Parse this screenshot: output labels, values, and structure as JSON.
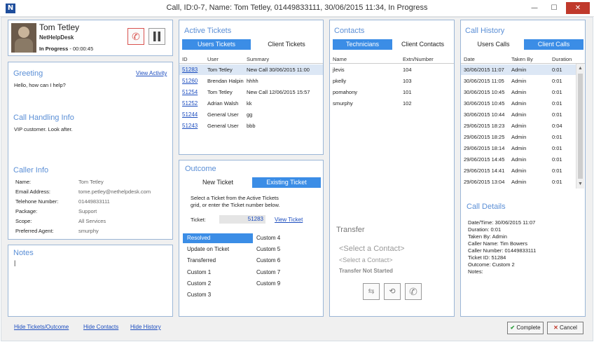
{
  "window": {
    "title": "Call, ID:0-7, Name: Tom Tetley, 01449833111, 30/06/2015 11:34, In Progress",
    "app_icon": "N",
    "minimize": "—",
    "maximize": "☐",
    "close": "✕"
  },
  "caller_card": {
    "name": "Tom Tetley",
    "company": "NetHelpDesk",
    "status": "In Progress",
    "timer": "- 00:00:45"
  },
  "greeting": {
    "title": "Greeting",
    "link": "View Activity",
    "text": "Hello, how can I help?"
  },
  "call_handling": {
    "title": "Call Handling Info",
    "text": "VIP customer. Look after."
  },
  "caller_info": {
    "title": "Caller Info",
    "rows": [
      {
        "label": "Name:",
        "value": "Tom Tetley"
      },
      {
        "label": "Email Address:",
        "value": "tome.petley@nethelpdesk.com"
      },
      {
        "label": "Telehone Number:",
        "value": "01449833111"
      },
      {
        "label": "Package:",
        "value": "Support"
      },
      {
        "label": "Scope:",
        "value": "All Services"
      },
      {
        "label": "Preferred Agent:",
        "value": "smurphy"
      }
    ]
  },
  "notes": {
    "title": "Notes",
    "cursor": "|"
  },
  "bottom_links": {
    "hide_tickets": "Hide Tickets/Outcome",
    "hide_contacts": "Hide Contacts",
    "hide_history": "Hide History"
  },
  "active_tickets": {
    "title": "Active Tickets",
    "tab_users": "Users Tickets",
    "tab_client": "Client Tickets",
    "headers": {
      "id": "ID",
      "user": "User",
      "summary": "Summary"
    },
    "rows": [
      {
        "id": "51283",
        "user": "Tom Tetley",
        "summary": "New Call 30/06/2015 11:00"
      },
      {
        "id": "51260",
        "user": "Brendan Halpin",
        "summary": "hhhh"
      },
      {
        "id": "51254",
        "user": "Tom Tetley",
        "summary": "New Call 12/06/2015 15:57"
      },
      {
        "id": "51252",
        "user": "Adrian Walsh",
        "summary": "kk"
      },
      {
        "id": "51244",
        "user": "General User",
        "summary": "gg"
      },
      {
        "id": "51243",
        "user": "General User",
        "summary": "bbb"
      }
    ]
  },
  "outcome": {
    "title": "Outcome",
    "tab_new": "New Ticket",
    "tab_existing": "Existing Ticket",
    "instruction_1": "Select a Ticket from the Active Tickets",
    "instruction_2": "grid, or enter the Ticket number below.",
    "ticket_label": "Ticket:",
    "ticket_value": "51283",
    "view_ticket": "View Ticket",
    "options_left": [
      "Resolved",
      "Update on Ticket",
      "Transferred",
      "Custom 1",
      "Custom 2",
      "Custom 3"
    ],
    "options_right": [
      "Custom 4",
      "Custom 5",
      "Custom 6",
      "Custom 7",
      "Custom 9"
    ]
  },
  "contacts": {
    "title": "Contacts",
    "tab_tech": "Technicians",
    "tab_client": "Client Contacts",
    "headers": {
      "name": "Name",
      "ext": "Extn/Number"
    },
    "rows": [
      {
        "name": "jlevis",
        "ext": "104"
      },
      {
        "name": "pkelly",
        "ext": "103"
      },
      {
        "name": "pomahony",
        "ext": "101"
      },
      {
        "name": "smurphy",
        "ext": "102"
      }
    ]
  },
  "transfer": {
    "title": "Transfer",
    "select_1": "<Select a Contact>",
    "select_2": "<Select a Contact>",
    "status": "Transfer Not Started"
  },
  "call_history": {
    "title": "Call History",
    "tab_users": "Users Calls",
    "tab_client": "Client Calls",
    "headers": {
      "date": "Date",
      "taken": "Taken By",
      "duration": "Duration"
    },
    "rows": [
      {
        "date": "30/06/2015 11:07",
        "taken": "Admin",
        "duration": "0:01"
      },
      {
        "date": "30/06/2015 11:05",
        "taken": "Admin",
        "duration": "0:01"
      },
      {
        "date": "30/06/2015 10:45",
        "taken": "Admin",
        "duration": "0:01"
      },
      {
        "date": "30/06/2015 10:45",
        "taken": "Admin",
        "duration": "0:01"
      },
      {
        "date": "30/06/2015 10:44",
        "taken": "Admin",
        "duration": "0:01"
      },
      {
        "date": "29/06/2015 18:23",
        "taken": "Admin",
        "duration": "0:04"
      },
      {
        "date": "29/06/2015 18:25",
        "taken": "Admin",
        "duration": "0:01"
      },
      {
        "date": "29/06/2015 18:14",
        "taken": "Admin",
        "duration": "0:01"
      },
      {
        "date": "29/06/2015 14:45",
        "taken": "Admin",
        "duration": "0:01"
      },
      {
        "date": "29/06/2015 14:41",
        "taken": "Admin",
        "duration": "0:01"
      },
      {
        "date": "29/06/2015 13:04",
        "taken": "Admin",
        "duration": "0:01"
      }
    ]
  },
  "call_details": {
    "title": "Call Details",
    "lines": [
      "Date/Time: 30/06/2015 11:07",
      "Duration: 0:01",
      "Taken By: Admin",
      "Caller Name: Tim Bowers",
      "Caller Number: 01449833111",
      "Ticket ID: 51284",
      "Outcome: Custom 2",
      "Notes:"
    ]
  },
  "buttons": {
    "complete": "Complete",
    "cancel": "Cancel"
  },
  "colors": {
    "accent": "#3b8de6",
    "panel_title": "#5b8fd6",
    "link": "#1c4dbf",
    "close_red": "#c0392b"
  }
}
